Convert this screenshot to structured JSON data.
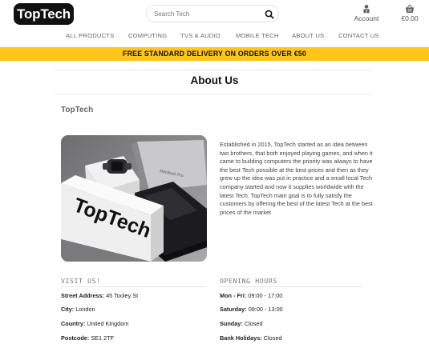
{
  "header": {
    "logo_text": "TopTech",
    "search_placeholder": "Search Tech",
    "account_label": "Account",
    "cart_total": "€0.00"
  },
  "nav": {
    "items": [
      "ALL PRODUCTS",
      "COMPUTING",
      "TVS & AUDIO",
      "MOBILE TECH",
      "ABOUT US",
      "CONTACT US"
    ]
  },
  "banner": {
    "text": "FREE STANDARD DELIVERY ON ORDERS OVER €50"
  },
  "main": {
    "title": "About Us",
    "company_name": "TopTech",
    "image": {
      "box_text": "TopTech",
      "laptop_text": "MacBook Pro"
    },
    "about_text": "Established in 2015, TopTech started as an idea between two brothers, that both enjoyed playing games, and when it came to building computers the priority was always to have the best Tech possible at the best prices and then as they grew up the idea was put in practice and a small local Tech company started and now it supplies worldwide with the latest Tech. TopTech main goal is to fully satisfy the customers by offering the best of the latest Tech at the best prices of the market"
  },
  "visit": {
    "heading": "VISIT US!",
    "rows": [
      {
        "label": "Street Address:",
        "value": "45 Tooley St"
      },
      {
        "label": "City:",
        "value": "London"
      },
      {
        "label": "Country:",
        "value": "United Kingdom"
      },
      {
        "label": "Postcode:",
        "value": "SE1 2TF"
      }
    ]
  },
  "hours": {
    "heading": "OPENING HOURS",
    "rows": [
      {
        "label": "Mon - Fri:",
        "value": "09:00 - 17:00"
      },
      {
        "label": "Saturday:",
        "value": "09:00 - 13:00"
      },
      {
        "label": "Sunday:",
        "value": "Closed"
      },
      {
        "label": "Bank Holidays:",
        "value": "Closed"
      }
    ]
  },
  "colors": {
    "banner": "#fec619",
    "logo_bg": "#111111",
    "text": "#222222"
  },
  "icons": {
    "search": "search-icon",
    "account": "user-icon",
    "cart": "basket-icon"
  }
}
